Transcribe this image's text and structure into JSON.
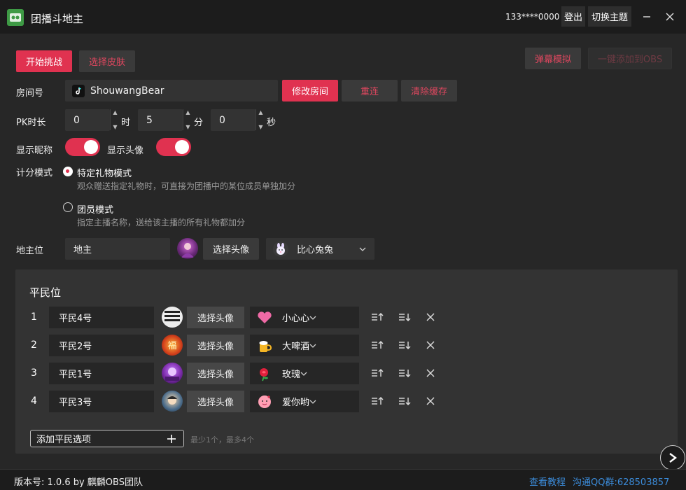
{
  "app": {
    "title": "团播斗地主",
    "user_phone": "133****0000",
    "logout_label": "登出",
    "theme_label": "切换主题",
    "minimize_icon": "minimize-icon",
    "close_icon": "close-icon"
  },
  "toolbar": {
    "start_label": "开始挑战",
    "skin_label": "选择皮肤",
    "danmaku_label": "弹幕模拟",
    "obs_label": "一键添加到OBS"
  },
  "room": {
    "label": "房间号",
    "value": "ShouwangBear",
    "modify_label": "修改房间",
    "reconnect_label": "重连",
    "clear_cache_label": "清除缓存"
  },
  "pk": {
    "label": "PK时长",
    "hours": "0",
    "hours_unit": "时",
    "minutes": "5",
    "minutes_unit": "分",
    "seconds": "0",
    "seconds_unit": "秒"
  },
  "display": {
    "nickname_label": "显示昵称",
    "nickname_on": true,
    "avatar_label": "显示头像",
    "avatar_on": true
  },
  "scoring": {
    "label": "计分模式",
    "options": [
      {
        "title": "特定礼物模式",
        "desc": "观众赠送指定礼物时，可直接为团播中的某位成员单独加分",
        "selected": true
      },
      {
        "title": "团员模式",
        "desc": "指定主播名称，送给该主播的所有礼物都加分",
        "selected": false
      }
    ]
  },
  "landlord": {
    "label": "地主位",
    "name": "地主",
    "choose_avatar_label": "选择头像",
    "gift": "比心兔兔"
  },
  "civilians": {
    "title": "平民位",
    "choose_avatar_label": "选择头像",
    "rows": [
      {
        "index": "1",
        "name": "平民4号",
        "gift": "小心心",
        "avatar_color": "#e9e9e9"
      },
      {
        "index": "2",
        "name": "平民2号",
        "gift": "大啤酒",
        "avatar_color": "#d2401c"
      },
      {
        "index": "3",
        "name": "平民1号",
        "gift": "玫瑰",
        "avatar_color": "#7a2aa8"
      },
      {
        "index": "4",
        "name": "平民3号",
        "gift": "爱你哟",
        "avatar_color": "#4a6b8a"
      }
    ],
    "add_label": "添加平民选项",
    "add_hint": "最少1个，最多4个"
  },
  "footer": {
    "version": "版本号: 1.0.6 by 麒麟OBS团队",
    "tutorial_label": "查看教程",
    "qq_group": "沟通QQ群:628503857"
  },
  "colors": {
    "accent": "#e03250",
    "background": "#272727",
    "link": "#3b8bd9"
  }
}
